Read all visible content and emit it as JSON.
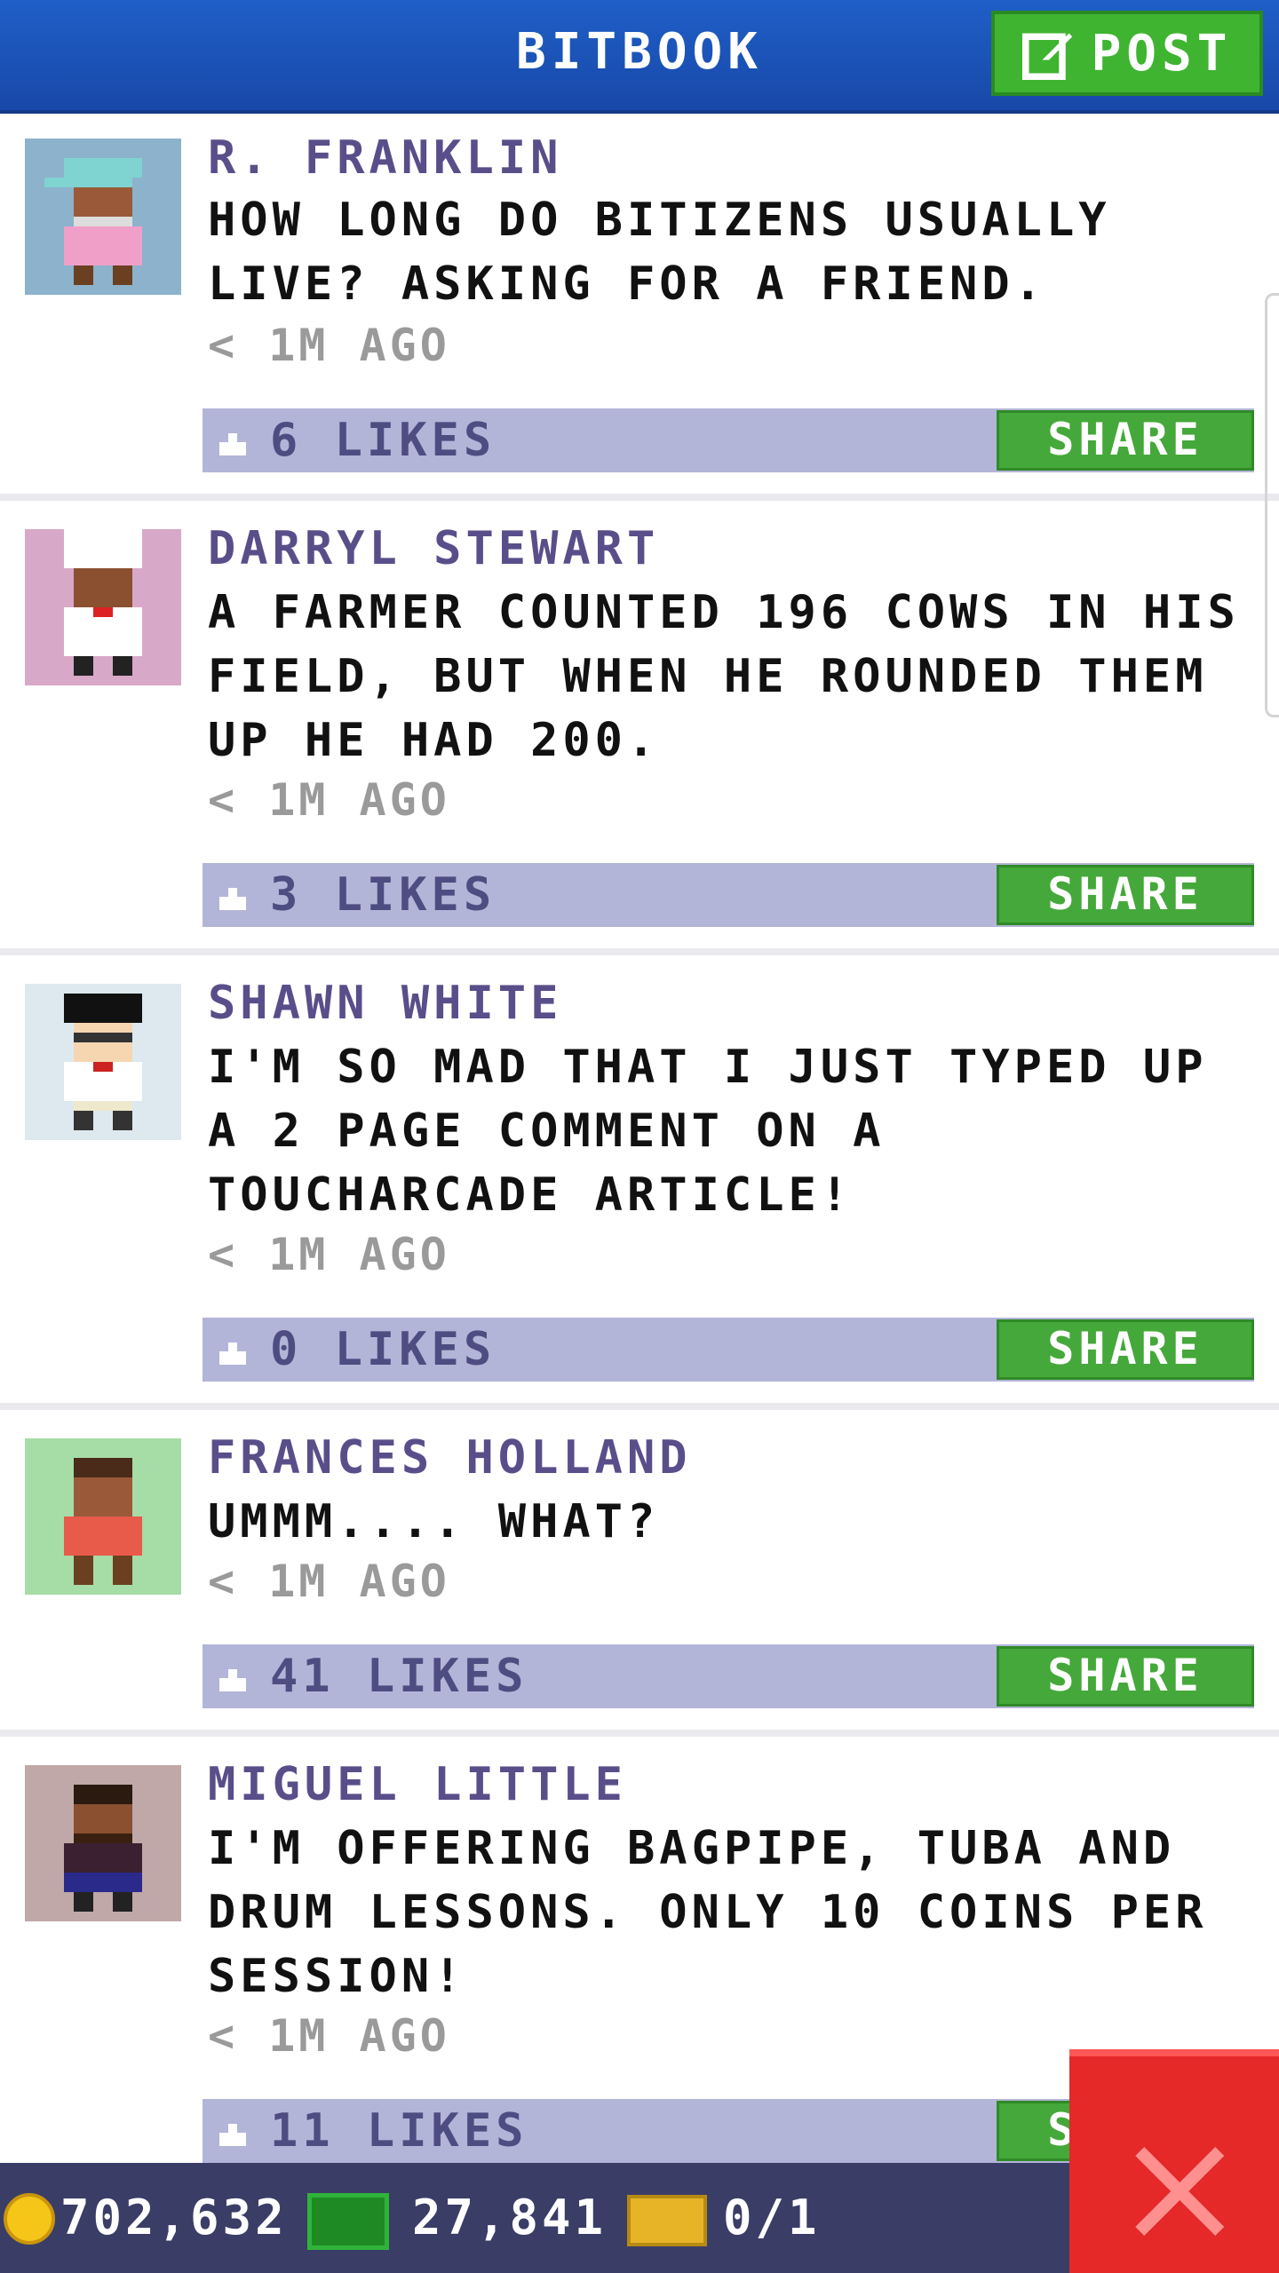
{
  "header": {
    "title": "BITBOOK",
    "post_label": "POST"
  },
  "posts": [
    {
      "name": "R. FRANKLIN",
      "message": "HOW LONG DO BITIZENS USUALLY LIVE? ASKING FOR A FRIEND.",
      "time": "< 1M AGO",
      "likes": "6 LIKES",
      "share_label": "SHARE",
      "avatar_bg": "#8cb2cc"
    },
    {
      "name": "DARRYL STEWART",
      "message": "A FARMER COUNTED 196 COWS IN HIS FIELD, BUT WHEN HE ROUNDED THEM UP HE HAD 200.",
      "time": "< 1M AGO",
      "likes": "3 LIKES",
      "share_label": "SHARE",
      "avatar_bg": "#d8a8c8"
    },
    {
      "name": "SHAWN WHITE",
      "message": "I'M SO MAD THAT I JUST TYPED UP A 2 PAGE COMMENT ON A TOUCHARCADE ARTICLE!",
      "time": "< 1M AGO",
      "likes": "0 LIKES",
      "share_label": "SHARE",
      "avatar_bg": "#dde9ef"
    },
    {
      "name": "FRANCES HOLLAND",
      "message": "UMMM....  WHAT?",
      "time": "< 1M AGO",
      "likes": "41 LIKES",
      "share_label": "SHARE",
      "avatar_bg": "#a6dca6"
    },
    {
      "name": "MIGUEL LITTLE",
      "message": "I'M OFFERING BAGPIPE, TUBA AND DRUM LESSONS. ONLY 10 COINS PER SESSION!",
      "time": "< 1M AGO",
      "likes": "11 LIKES",
      "share_label": "SHARE",
      "avatar_bg": "#c0a8a8"
    }
  ],
  "bottom_bar": {
    "coins": "702,632",
    "bux": "27,841",
    "tickets": "0/1"
  }
}
